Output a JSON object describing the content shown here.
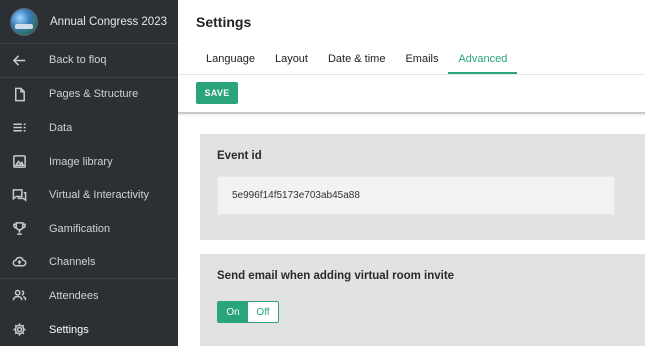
{
  "sidebar": {
    "title": "Annual Congress 2023",
    "items": [
      {
        "label": "Back to floq",
        "icon": "arrow-left-icon"
      },
      {
        "label": "Pages & Structure",
        "icon": "page-icon"
      },
      {
        "label": "Data",
        "icon": "list-icon"
      },
      {
        "label": "Image library",
        "icon": "image-icon"
      },
      {
        "label": "Virtual & Interactivity",
        "icon": "chat-icon"
      },
      {
        "label": "Gamification",
        "icon": "trophy-icon"
      },
      {
        "label": "Channels",
        "icon": "cloud-upload-icon"
      },
      {
        "label": "Attendees",
        "icon": "people-icon"
      },
      {
        "label": "Settings",
        "icon": "gear-icon"
      }
    ]
  },
  "header": {
    "title": "Settings",
    "tabs": [
      "Language",
      "Layout",
      "Date & time",
      "Emails",
      "Advanced"
    ],
    "active_tab": "Advanced",
    "save_label": "SAVE"
  },
  "event_id": {
    "label": "Event id",
    "value": "5e996f14f5173e703ab45a88"
  },
  "virtual_invite": {
    "label": "Send email when adding virtual room invite",
    "on_label": "On",
    "off_label": "Off",
    "selected": "On"
  },
  "colors": {
    "accent": "#2aa57a",
    "sidebar_bg": "#2c2f33"
  }
}
